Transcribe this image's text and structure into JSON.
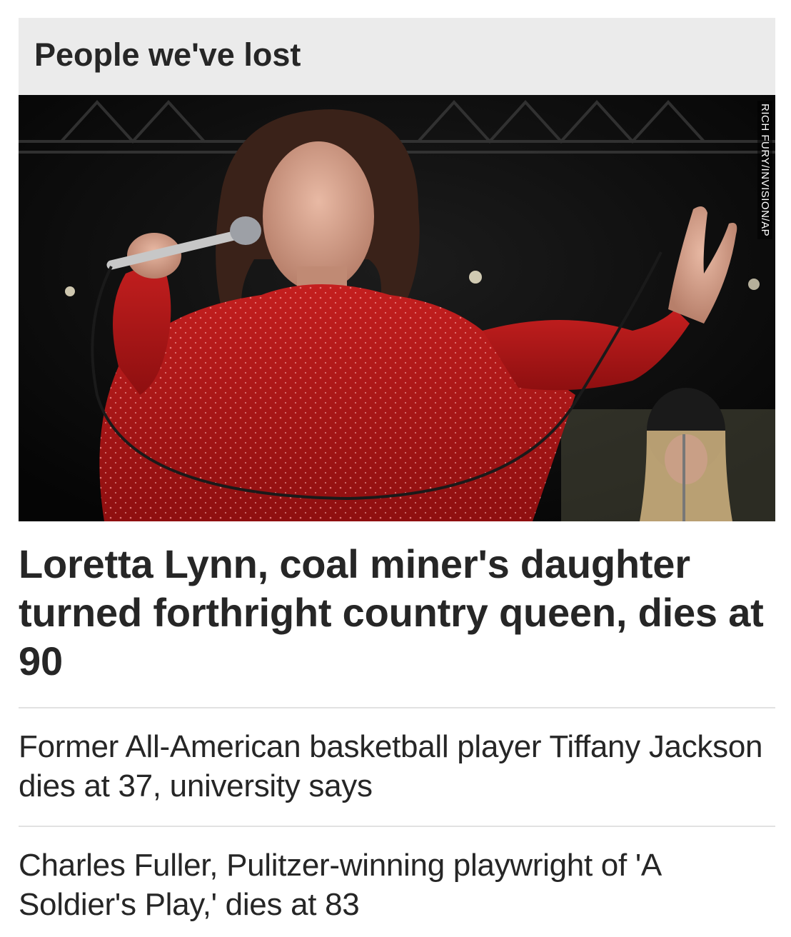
{
  "section": {
    "title": "People we've lost"
  },
  "hero": {
    "photo_credit": "RICH FURY/INVISION/AP",
    "headline": "Loretta Lynn, coal miner's daughter turned forthright country queen, dies at 90"
  },
  "stories": [
    {
      "headline": "Former All-American basketball player Tiffany Jackson dies at 37, university says"
    },
    {
      "headline": "Charles Fuller, Pulitzer-winning playwright of 'A Soldier's Play,' dies at 83"
    }
  ],
  "colors": {
    "header_bg": "#ebebeb",
    "text": "#262626",
    "divider": "#e2e2e2",
    "dress_red": "#b01818"
  }
}
